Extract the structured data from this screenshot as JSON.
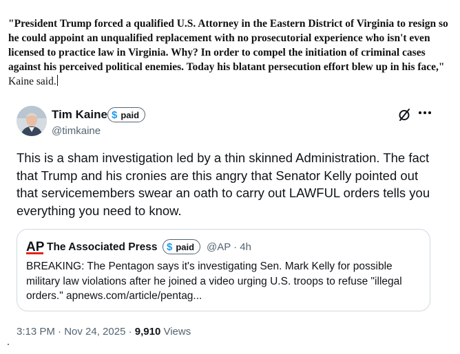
{
  "article": {
    "quote_bold": "\"President Trump forced a qualified U.S. Attorney in the Eastern District of Virginia to resign so he could appoint an unqualified replacement with no prosecutorial experience who isn't even licensed to practice law in Virginia. Why? In order to compel the initiation of criminal cases against his perceived political enemies. Today his blatant persecution effort blew up in his face,\"",
    "quote_tail": " Kaine said."
  },
  "tweet": {
    "author_name": "Tim Kaine",
    "badge_label": "paid",
    "badge_symbol": "$",
    "handle": "@timkaine",
    "text": "This is a sham investigation led by a thin skinned Administration. The fact that Trump and his cronies are this angry that Senator Kelly pointed out that servicemembers swear an oath to carry out LAWFUL orders tells you everything you need to know.",
    "icons": [
      "grok-icon",
      "more-icon"
    ],
    "timestamp": "3:13 PM · Nov 24, 2025 · ",
    "views_count": "9,910",
    "views_label": " Views"
  },
  "quoted_tweet": {
    "logo": "AP",
    "author_name": "The Associated Press",
    "badge_label": "paid",
    "badge_symbol": "$",
    "meta": "@AP · 4h",
    "text": "BREAKING: The Pentagon says it's investigating Sen. Mark Kelly for possible military law violations after he joined a video urging U.S. troops to refuse \"illegal orders.\" apnews.com/article/pentag..."
  },
  "colors": {
    "text": "#0f1419",
    "secondary": "#536471",
    "accent": "#1d9bf0",
    "border": "#cfd9de",
    "ap_red": "#e2231a"
  }
}
